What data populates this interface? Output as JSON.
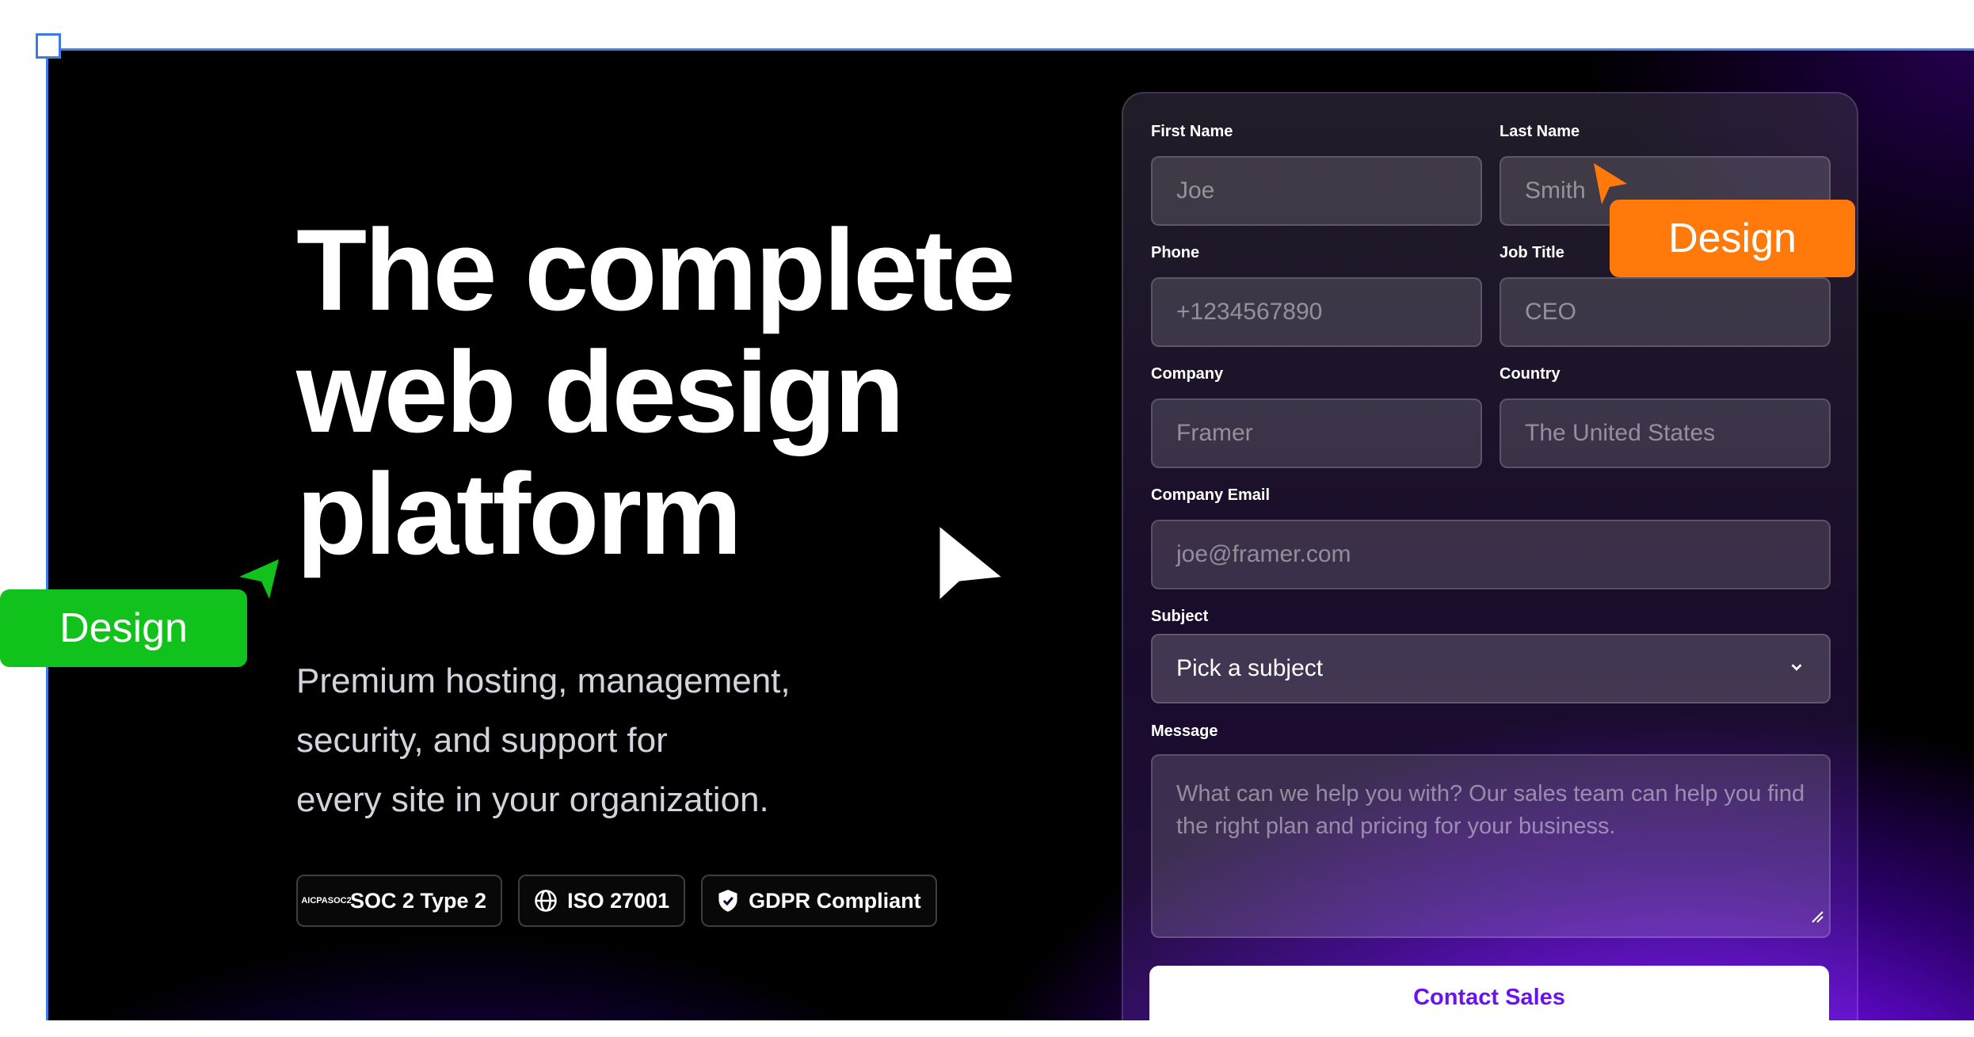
{
  "hero": {
    "title_lines": [
      "The complete",
      "web design",
      "platform"
    ],
    "subtitle_lines": [
      "Premium hosting, management,",
      "security, and support for",
      "every site in your organization."
    ],
    "badges": [
      {
        "icon": "aicpa-soc2-icon",
        "icon_text_top": "AICPA",
        "icon_text_bottom": "SOC2",
        "label": "SOC 2 Type 2"
      },
      {
        "icon": "globe-icon",
        "label": "ISO 27001"
      },
      {
        "icon": "shield-check-icon",
        "label": "GDPR Compliant"
      }
    ]
  },
  "form": {
    "first_name": {
      "label": "First Name",
      "placeholder": "Joe"
    },
    "last_name": {
      "label": "Last Name",
      "placeholder": "Smith"
    },
    "phone": {
      "label": "Phone",
      "placeholder": "+1234567890"
    },
    "job_title": {
      "label": "Job Title",
      "placeholder": "CEO"
    },
    "company": {
      "label": "Company",
      "placeholder": "Framer"
    },
    "country": {
      "label": "Country",
      "placeholder": "The United States"
    },
    "email": {
      "label": "Company Email",
      "placeholder": "joe@framer.com"
    },
    "subject": {
      "label": "Subject",
      "value": "Pick a subject"
    },
    "message": {
      "label": "Message",
      "placeholder": "What can we help you with? Our sales team can help you find the right plan and pricing for your business."
    },
    "submit_label": "Contact Sales"
  },
  "collab_tags": [
    {
      "label": "Design",
      "color": "#ff7a0a"
    },
    {
      "label": "Design",
      "color": "#12c21c"
    }
  ],
  "colors": {
    "frame_border": "#3d7be8",
    "accent_purple": "#6a12f0",
    "background": "#000000"
  }
}
